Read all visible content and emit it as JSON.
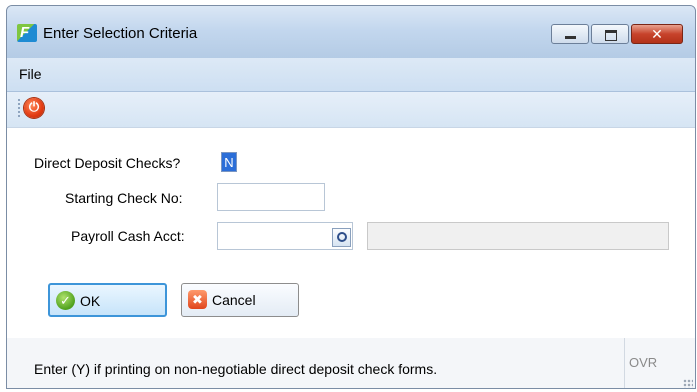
{
  "window": {
    "title": "Enter Selection Criteria",
    "app_icon_letter": "F"
  },
  "menu": {
    "file": "File"
  },
  "toolbar": {
    "power_icon": "power-icon"
  },
  "form": {
    "direct_deposit_label": "Direct Deposit Checks?",
    "direct_deposit_value": "N",
    "starting_check_label": "Starting Check No:",
    "starting_check_value": "",
    "payroll_cash_label": "Payroll Cash Acct:",
    "payroll_cash_value": "",
    "payroll_cash_desc": ""
  },
  "buttons": {
    "ok": "OK",
    "cancel": "Cancel"
  },
  "status": {
    "message": "Enter (Y) if printing on non-negotiable direct deposit check forms.",
    "mode": "OVR"
  }
}
